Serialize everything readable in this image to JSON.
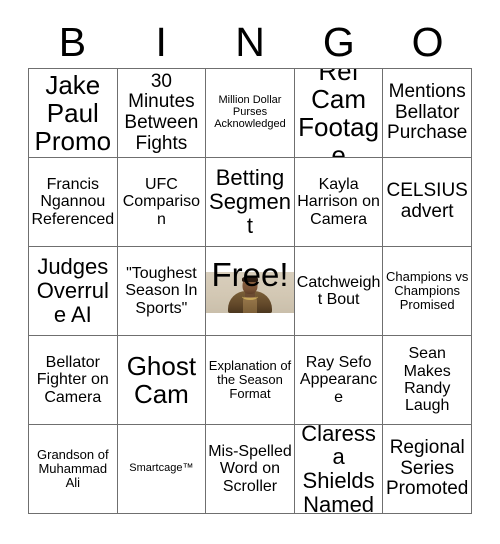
{
  "header": {
    "letters": [
      "B",
      "I",
      "N",
      "G",
      "O"
    ]
  },
  "free_space": {
    "label": "Free!",
    "image_alt": "fighter-portrait",
    "image_bg_color": "#d3c8b4"
  },
  "style": {
    "border_color": "#6f6f6f",
    "background_color": "#ffffff",
    "text_color": "#000000"
  },
  "grid": {
    "rows": 5,
    "columns": 5,
    "cells": [
      [
        {
          "text": "Jake Paul Promo",
          "size": "fs-xxl"
        },
        {
          "text": "30 Minutes Between Fights",
          "size": "fs-l"
        },
        {
          "text": "Million Dollar Purses Acknowledged",
          "size": "fs-xs"
        },
        {
          "text": "Ref Cam Footage",
          "size": "fs-xxl"
        },
        {
          "text": "Mentions Bellator Purchase",
          "size": "fs-l"
        }
      ],
      [
        {
          "text": "Francis Ngannou Referenced",
          "size": "fs-m"
        },
        {
          "text": "UFC Comparison",
          "size": "fs-m"
        },
        {
          "text": "Betting Segment",
          "size": "fs-xl"
        },
        {
          "text": "Kayla Harrison on Camera",
          "size": "fs-m"
        },
        {
          "text": "CELSIUS advert",
          "size": "fs-l"
        }
      ],
      [
        {
          "text": "Judges Overrule AI",
          "size": "fs-xl"
        },
        {
          "text": "\"Toughest Season In Sports\"",
          "size": "fs-m"
        },
        {
          "text": "Free!",
          "size": "free"
        },
        {
          "text": "Catchweight Bout",
          "size": "fs-m"
        },
        {
          "text": "Champions vs Champions Promised",
          "size": "fs-s"
        }
      ],
      [
        {
          "text": "Bellator Fighter on Camera",
          "size": "fs-m"
        },
        {
          "text": "Ghost Cam",
          "size": "fs-xxl"
        },
        {
          "text": "Explanation of the Season Format",
          "size": "fs-s"
        },
        {
          "text": "Ray Sefo Appearance",
          "size": "fs-m"
        },
        {
          "text": "Sean Makes Randy Laugh",
          "size": "fs-m"
        }
      ],
      [
        {
          "text": "Grandson of Muhammad Ali",
          "size": "fs-s"
        },
        {
          "text": "Smartcage™",
          "size": "fs-xs"
        },
        {
          "text": "Mis-Spelled Word on Scroller",
          "size": "fs-m"
        },
        {
          "text": "Claressa Shields Named",
          "size": "fs-xl"
        },
        {
          "text": "Regional Series Promoted",
          "size": "fs-l"
        }
      ]
    ]
  }
}
